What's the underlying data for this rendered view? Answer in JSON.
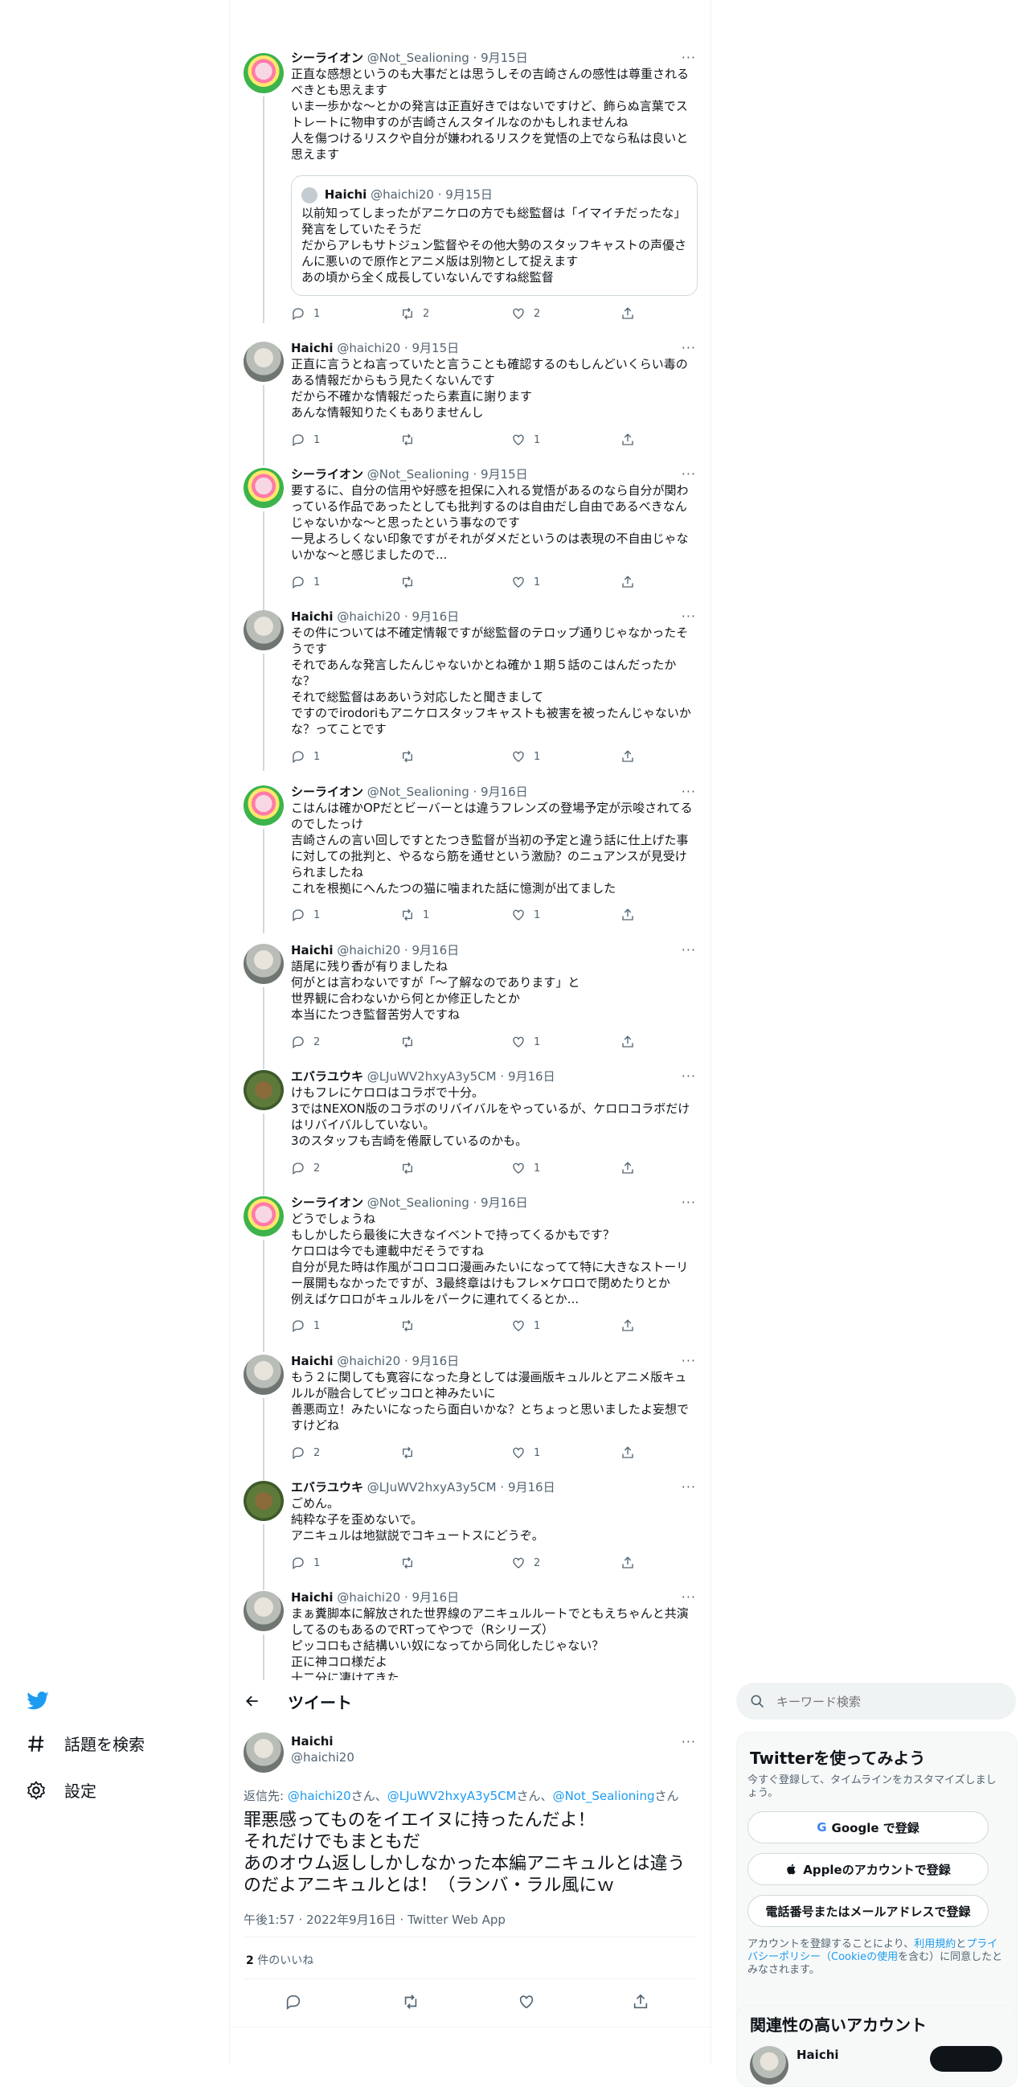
{
  "colors": {
    "accent": "#1d9bf0",
    "text": "#0f1419",
    "muted": "#536471",
    "border": "#eff3f4"
  },
  "nav": {
    "logo": "twitter-bird-icon",
    "explore_label": "話題を検索",
    "settings_label": "設定"
  },
  "header": {
    "title": "ツイート"
  },
  "tweets": [
    {
      "name": "シーライオン",
      "handle": "@Not_Sealioning",
      "date": "9月15日",
      "body": "正直な感想というのも大事だとは思うしその吉崎さんの感性は尊重されるべきとも思えます\nいま一歩かな～とかの発言は正直好きではないですけど、飾らぬ言葉でストレートに物申すのが吉崎さんスタイルなのかもしれませんね\n人を傷つけるリスクや自分が嫌われるリスクを覚悟の上でなら私は良いと思えます",
      "quote": {
        "name": "Haichi",
        "handle": "@haichi20",
        "date": "9月15日",
        "body": "以前知ってしまったがアニケロの方でも総監督は「イマイチだったな」発言をしていたそうだ\nだからアレもサトジュン監督やその他大勢のスタッフキャストの声優さんに悪いので原作とアニメ版は別物として捉えます\nあの頃から全く成長していないんですね総監督"
      },
      "replies": "1",
      "retweets": "2",
      "likes": "2"
    },
    {
      "name": "Haichi",
      "handle": "@haichi20",
      "date": "9月15日",
      "body": "正直に言うとね言っていたと言うことも確認するのもしんどいくらい毒のある情報だからもう見たくないんです\nだから不確かな情報だったら素直に謝ります\nあんな情報知りたくもありませんし",
      "replies": "1",
      "retweets": "",
      "likes": "1"
    },
    {
      "name": "シーライオン",
      "handle": "@Not_Sealioning",
      "date": "9月15日",
      "body": "要するに、自分の信用や好感を担保に入れる覚悟があるのなら自分が関わっている作品であったとしても批判するのは自由だし自由であるべきなんじゃないかな～と思ったという事なのです\n一見よろしくない印象ですがそれがダメだというのは表現の不自由じゃないかな～と感じましたので...",
      "replies": "1",
      "retweets": "",
      "likes": "1"
    },
    {
      "name": "Haichi",
      "handle": "@haichi20",
      "date": "9月16日",
      "body": "その件については不確定情報ですが総監督のテロップ通りじゃなかったそうです\nそれであんな発言したんじゃないかとね確か１期５話のこはんだったかな？\nそれで総監督はああいう対応したと聞きまして\nですのでirodoriもアニケロスタッフキャストも被害を被ったんじゃないかな？ってことです",
      "replies": "1",
      "retweets": "",
      "likes": "1"
    },
    {
      "name": "シーライオン",
      "handle": "@Not_Sealioning",
      "date": "9月16日",
      "body": "こはんは確かOPだとビーバーとは違うフレンズの登場予定が示唆されてるのでしたっけ\n吉崎さんの言い回しですとたつき監督が当初の予定と違う話に仕上げた事に対しての批判と、やるなら筋を通せという激励？のニュアンスが見受けられましたね\nこれを根拠にへんたつの猫に噛まれた話に憶測が出てました",
      "replies": "1",
      "retweets": "1",
      "likes": "1"
    },
    {
      "name": "Haichi",
      "handle": "@haichi20",
      "date": "9月16日",
      "body": "語尾に残り香が有りましたね\n何がとは言わないですが「～了解なのであります」と\n世界観に合わないから何とか修正したとか\n本当にたつき監督苦労人ですね",
      "replies": "2",
      "retweets": "",
      "likes": "1"
    },
    {
      "name": "エバラユウキ",
      "handle": "@LJuWV2hxyA3y5CM",
      "date": "9月16日",
      "body": "けもフレにケロロはコラボで十分。\n3ではNEXON版のコラボのリバイバルをやっているが、ケロロコラボだけはリバイバルしていない。\n3のスタッフも吉崎を倦厭しているのかも。",
      "replies": "2",
      "retweets": "",
      "likes": "1"
    },
    {
      "name": "シーライオン",
      "handle": "@Not_Sealioning",
      "date": "9月16日",
      "body": "どうでしょうね\nもしかしたら最後に大きなイベントで持ってくるかもです？\nケロロは今でも連載中だそうですね\n自分が見た時は作風がコロコロ漫画みたいになってて特に大きなストーリー展開もなかったですが、3最終章はけもフレ×ケロロで閉めたりとか\n例えばケロロがキュルルをパークに連れてくるとか...",
      "replies": "1",
      "retweets": "",
      "likes": "1"
    },
    {
      "name": "Haichi",
      "handle": "@haichi20",
      "date": "9月16日",
      "body": "もう２に関しても寛容になった身としては漫画版キュルルとアニメ版キュルルが融合してピッコロと神みたいに\n善悪両立！みたいになったら面白いかな？とちょっと思いましたよ妄想ですけどね",
      "replies": "2",
      "retweets": "",
      "likes": "1"
    },
    {
      "name": "エバラユウキ",
      "handle": "@LJuWV2hxyA3y5CM",
      "date": "9月16日",
      "body": "ごめん。\n純粋な子を歪めないで。\nアニキュルは地獄説でコキュートスにどうぞ。",
      "replies": "1",
      "retweets": "",
      "likes": "2"
    },
    {
      "name": "Haichi",
      "handle": "@haichi20",
      "date": "9月16日",
      "body": "まぁ糞脚本に解放された世界線のアニキュルルートでともえちゃんと共演してるのもあるのでRTってやつで（Rシリーズ）\nピッコロもさ結構いい奴になってから同化したじゃない？\n正に神コロ様だよ\n十二分に凄けてきた",
      "replies": "",
      "retweets": "",
      "likes": ""
    }
  ],
  "focus": {
    "name": "Haichi",
    "handle": "@haichi20",
    "reply_prefix": "返信先: ",
    "reply_to_1": "@haichi20",
    "reply_to_2": "@LJuWV2hxyA3y5CM",
    "reply_to_3": "@Not_Sealioning",
    "san": "さん",
    "san_comma": "さん、",
    "body": "罪悪感ってものをイエイヌに持ったんだよ！\nそれだけでもまともだ\nあのオウム返ししかしなかった本編アニキュルとは違うのだよアニキュルとは！（ランバ・ラル風にｗ",
    "timestamp": "午後1:57 · 2022年9月16日 · Twitter Web App",
    "likes_count": "2",
    "likes_label": "件のいいね"
  },
  "right": {
    "search_placeholder": "キーワード検索",
    "signup_title": "Twitterを使ってみよう",
    "signup_desc": "今すぐ登録して、タイムラインをカスタマイズしましょう。",
    "google_btn": "Google で登録",
    "apple_btn": "Appleのアカウントで登録",
    "phone_btn": "電話番号またはメールアドレスで登録",
    "terms_1": "アカウントを登録することにより、",
    "terms_link_1": "利用規約",
    "terms_2": "と",
    "terms_link_2": "プライバシーポリシー（Cookieの使用",
    "terms_3": "を含む）に同意したとみなされます。",
    "related_title": "関連性の高いアカウント",
    "related_name": "Haichi"
  }
}
